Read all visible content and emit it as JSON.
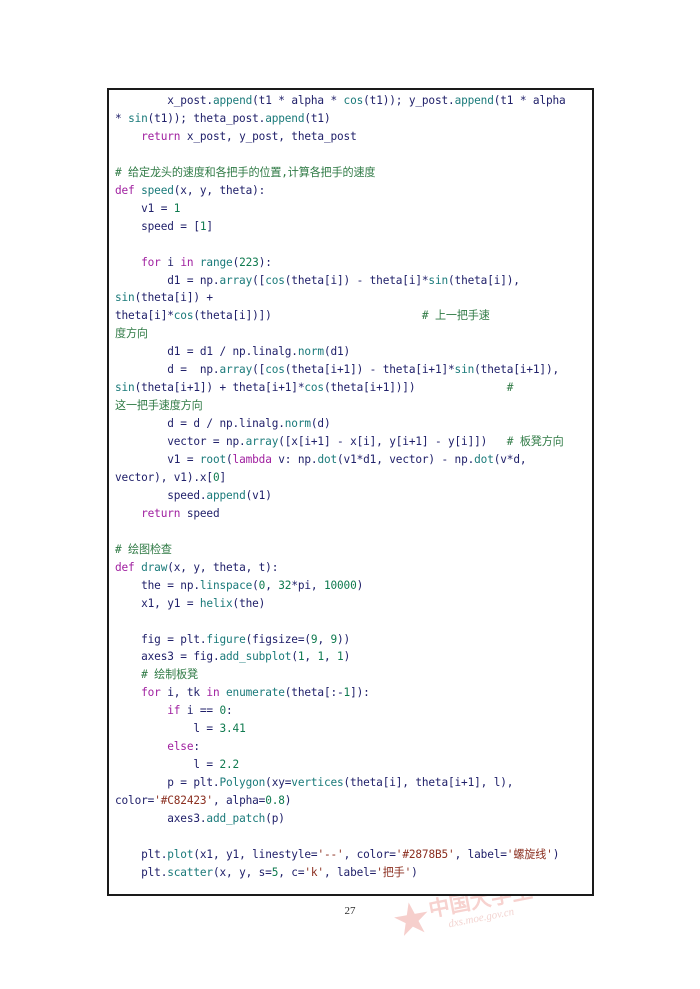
{
  "document": {
    "page_number": "27",
    "watermark": {
      "star": "★",
      "text_cn": "中国大学生",
      "url": "dxs.moe.gov.cn"
    }
  },
  "colors": {
    "keyword": "#a020a0",
    "function": "#1a7a7a",
    "number": "#0f7a4f",
    "string": "#8b2f20",
    "comment": "#2f7a45",
    "identifier": "#20206a",
    "border": "#1a1a1a",
    "polygon_color_literal": "#C82423",
    "plot_color_literal": "#2878B5"
  },
  "code": {
    "language": "python",
    "lines": [
      {
        "indent": 0,
        "tokens": [
          {
            "t": "        ",
            "c": "id"
          },
          {
            "t": "x_post",
            "c": "id"
          },
          {
            "t": ".",
            "c": "id"
          },
          {
            "t": "append",
            "c": "fn"
          },
          {
            "t": "(t1 * alpha * ",
            "c": "id"
          },
          {
            "t": "cos",
            "c": "fn"
          },
          {
            "t": "(t1)); ",
            "c": "id"
          },
          {
            "t": "y_post",
            "c": "id"
          },
          {
            "t": ".",
            "c": "id"
          },
          {
            "t": "append",
            "c": "fn"
          },
          {
            "t": "(t1 * alpha",
            "c": "id"
          }
        ]
      },
      {
        "indent": 0,
        "tokens": [
          {
            "t": "* ",
            "c": "id"
          },
          {
            "t": "sin",
            "c": "fn"
          },
          {
            "t": "(t1)); theta_post",
            "c": "id"
          },
          {
            "t": ".",
            "c": "id"
          },
          {
            "t": "append",
            "c": "fn"
          },
          {
            "t": "(t1)",
            "c": "id"
          }
        ]
      },
      {
        "indent": 0,
        "tokens": [
          {
            "t": "    ",
            "c": "id"
          },
          {
            "t": "return",
            "c": "kw"
          },
          {
            "t": " x_post, y_post, theta_post",
            "c": "id"
          }
        ]
      },
      {
        "indent": 0,
        "tokens": []
      },
      {
        "indent": 0,
        "tokens": [
          {
            "t": "# 给定龙头的速度和各把手的位置,计算各把手的速度",
            "c": "cm"
          }
        ]
      },
      {
        "indent": 0,
        "tokens": [
          {
            "t": "def",
            "c": "kw"
          },
          {
            "t": " ",
            "c": "id"
          },
          {
            "t": "speed",
            "c": "fn"
          },
          {
            "t": "(x, y, theta):",
            "c": "id"
          }
        ]
      },
      {
        "indent": 0,
        "tokens": [
          {
            "t": "    v1 = ",
            "c": "id"
          },
          {
            "t": "1",
            "c": "num"
          }
        ]
      },
      {
        "indent": 0,
        "tokens": [
          {
            "t": "    speed = [",
            "c": "id"
          },
          {
            "t": "1",
            "c": "num"
          },
          {
            "t": "]",
            "c": "id"
          }
        ]
      },
      {
        "indent": 0,
        "tokens": []
      },
      {
        "indent": 0,
        "tokens": [
          {
            "t": "    ",
            "c": "id"
          },
          {
            "t": "for",
            "c": "kw"
          },
          {
            "t": " i ",
            "c": "id"
          },
          {
            "t": "in",
            "c": "kw"
          },
          {
            "t": " ",
            "c": "id"
          },
          {
            "t": "range",
            "c": "fn"
          },
          {
            "t": "(",
            "c": "id"
          },
          {
            "t": "223",
            "c": "num"
          },
          {
            "t": "):",
            "c": "id"
          }
        ]
      },
      {
        "indent": 0,
        "tokens": [
          {
            "t": "        d1 = np.",
            "c": "id"
          },
          {
            "t": "array",
            "c": "fn"
          },
          {
            "t": "([",
            "c": "id"
          },
          {
            "t": "cos",
            "c": "fn"
          },
          {
            "t": "(theta[i]) - theta[i]*",
            "c": "id"
          },
          {
            "t": "sin",
            "c": "fn"
          },
          {
            "t": "(theta[i]),",
            "c": "id"
          }
        ]
      },
      {
        "indent": 0,
        "tokens": [
          {
            "t": "sin",
            "c": "fn"
          },
          {
            "t": "(theta[i]) +",
            "c": "id"
          }
        ]
      },
      {
        "indent": 0,
        "tokens": [
          {
            "t": "theta[i]*",
            "c": "id"
          },
          {
            "t": "cos",
            "c": "fn"
          },
          {
            "t": "(theta[i])])",
            "c": "id"
          },
          {
            "t": "                       ",
            "c": "id"
          },
          {
            "t": "# 上一把手速",
            "c": "cm"
          }
        ]
      },
      {
        "indent": 0,
        "tokens": [
          {
            "t": "度方向",
            "c": "cm"
          }
        ]
      },
      {
        "indent": 0,
        "tokens": [
          {
            "t": "        d1 = d1 / np.linalg.",
            "c": "id"
          },
          {
            "t": "norm",
            "c": "fn"
          },
          {
            "t": "(d1)",
            "c": "id"
          }
        ]
      },
      {
        "indent": 0,
        "tokens": [
          {
            "t": "        d =  np.",
            "c": "id"
          },
          {
            "t": "array",
            "c": "fn"
          },
          {
            "t": "([",
            "c": "id"
          },
          {
            "t": "cos",
            "c": "fn"
          },
          {
            "t": "(theta[i+1]) - theta[i+1]*",
            "c": "id"
          },
          {
            "t": "sin",
            "c": "fn"
          },
          {
            "t": "(theta[i+1]),",
            "c": "id"
          }
        ]
      },
      {
        "indent": 0,
        "tokens": [
          {
            "t": "sin",
            "c": "fn"
          },
          {
            "t": "(theta[i+1]) + theta[i+1]*",
            "c": "id"
          },
          {
            "t": "cos",
            "c": "fn"
          },
          {
            "t": "(theta[i+1])])",
            "c": "id"
          },
          {
            "t": "              ",
            "c": "id"
          },
          {
            "t": "#",
            "c": "cm"
          }
        ]
      },
      {
        "indent": 0,
        "tokens": [
          {
            "t": "这一把手速度方向",
            "c": "cm"
          }
        ]
      },
      {
        "indent": 0,
        "tokens": [
          {
            "t": "        d = d / np.linalg.",
            "c": "id"
          },
          {
            "t": "norm",
            "c": "fn"
          },
          {
            "t": "(d)",
            "c": "id"
          }
        ]
      },
      {
        "indent": 0,
        "tokens": [
          {
            "t": "        vector = np.",
            "c": "id"
          },
          {
            "t": "array",
            "c": "fn"
          },
          {
            "t": "([x[i+1] - x[i], y[i+1] - y[i]])",
            "c": "id"
          },
          {
            "t": "   ",
            "c": "id"
          },
          {
            "t": "# 板凳方向",
            "c": "cm"
          }
        ]
      },
      {
        "indent": 0,
        "tokens": [
          {
            "t": "        v1 = ",
            "c": "id"
          },
          {
            "t": "root",
            "c": "fn"
          },
          {
            "t": "(",
            "c": "id"
          },
          {
            "t": "lambda",
            "c": "kw"
          },
          {
            "t": " v: np.",
            "c": "id"
          },
          {
            "t": "dot",
            "c": "fn"
          },
          {
            "t": "(v1*d1, vector) - np.",
            "c": "id"
          },
          {
            "t": "dot",
            "c": "fn"
          },
          {
            "t": "(v*d,",
            "c": "id"
          }
        ]
      },
      {
        "indent": 0,
        "tokens": [
          {
            "t": "vector), v1).x[",
            "c": "id"
          },
          {
            "t": "0",
            "c": "num"
          },
          {
            "t": "]",
            "c": "id"
          }
        ]
      },
      {
        "indent": 0,
        "tokens": [
          {
            "t": "        speed.",
            "c": "id"
          },
          {
            "t": "append",
            "c": "fn"
          },
          {
            "t": "(v1)",
            "c": "id"
          }
        ]
      },
      {
        "indent": 0,
        "tokens": [
          {
            "t": "    ",
            "c": "id"
          },
          {
            "t": "return",
            "c": "kw"
          },
          {
            "t": " speed",
            "c": "id"
          }
        ]
      },
      {
        "indent": 0,
        "tokens": []
      },
      {
        "indent": 0,
        "tokens": [
          {
            "t": "# 绘图检查",
            "c": "cm"
          }
        ]
      },
      {
        "indent": 0,
        "tokens": [
          {
            "t": "def",
            "c": "kw"
          },
          {
            "t": " ",
            "c": "id"
          },
          {
            "t": "draw",
            "c": "fn"
          },
          {
            "t": "(x, y, theta, t):",
            "c": "id"
          }
        ]
      },
      {
        "indent": 0,
        "tokens": [
          {
            "t": "    the = np.",
            "c": "id"
          },
          {
            "t": "linspace",
            "c": "fn"
          },
          {
            "t": "(",
            "c": "id"
          },
          {
            "t": "0",
            "c": "num"
          },
          {
            "t": ", ",
            "c": "id"
          },
          {
            "t": "32",
            "c": "num"
          },
          {
            "t": "*pi, ",
            "c": "id"
          },
          {
            "t": "10000",
            "c": "num"
          },
          {
            "t": ")",
            "c": "id"
          }
        ]
      },
      {
        "indent": 0,
        "tokens": [
          {
            "t": "    x1, y1 = ",
            "c": "id"
          },
          {
            "t": "helix",
            "c": "fn"
          },
          {
            "t": "(the)",
            "c": "id"
          }
        ]
      },
      {
        "indent": 0,
        "tokens": []
      },
      {
        "indent": 0,
        "tokens": [
          {
            "t": "    fig = plt.",
            "c": "id"
          },
          {
            "t": "figure",
            "c": "fn"
          },
          {
            "t": "(figsize=(",
            "c": "id"
          },
          {
            "t": "9",
            "c": "num"
          },
          {
            "t": ", ",
            "c": "id"
          },
          {
            "t": "9",
            "c": "num"
          },
          {
            "t": "))",
            "c": "id"
          }
        ]
      },
      {
        "indent": 0,
        "tokens": [
          {
            "t": "    axes3 = fig.",
            "c": "id"
          },
          {
            "t": "add_subplot",
            "c": "fn"
          },
          {
            "t": "(",
            "c": "id"
          },
          {
            "t": "1",
            "c": "num"
          },
          {
            "t": ", ",
            "c": "id"
          },
          {
            "t": "1",
            "c": "num"
          },
          {
            "t": ", ",
            "c": "id"
          },
          {
            "t": "1",
            "c": "num"
          },
          {
            "t": ")",
            "c": "id"
          }
        ]
      },
      {
        "indent": 0,
        "tokens": [
          {
            "t": "    ",
            "c": "id"
          },
          {
            "t": "# 绘制板凳",
            "c": "cm"
          }
        ]
      },
      {
        "indent": 0,
        "tokens": [
          {
            "t": "    ",
            "c": "id"
          },
          {
            "t": "for",
            "c": "kw"
          },
          {
            "t": " i, tk ",
            "c": "id"
          },
          {
            "t": "in",
            "c": "kw"
          },
          {
            "t": " ",
            "c": "id"
          },
          {
            "t": "enumerate",
            "c": "fn"
          },
          {
            "t": "(theta[:-",
            "c": "id"
          },
          {
            "t": "1",
            "c": "num"
          },
          {
            "t": "]):",
            "c": "id"
          }
        ]
      },
      {
        "indent": 0,
        "tokens": [
          {
            "t": "        ",
            "c": "id"
          },
          {
            "t": "if",
            "c": "kw"
          },
          {
            "t": " i == ",
            "c": "id"
          },
          {
            "t": "0",
            "c": "num"
          },
          {
            "t": ":",
            "c": "id"
          }
        ]
      },
      {
        "indent": 0,
        "tokens": [
          {
            "t": "            l = ",
            "c": "id"
          },
          {
            "t": "3.41",
            "c": "num"
          }
        ]
      },
      {
        "indent": 0,
        "tokens": [
          {
            "t": "        ",
            "c": "id"
          },
          {
            "t": "else",
            "c": "kw"
          },
          {
            "t": ":",
            "c": "id"
          }
        ]
      },
      {
        "indent": 0,
        "tokens": [
          {
            "t": "            l = ",
            "c": "id"
          },
          {
            "t": "2.2",
            "c": "num"
          }
        ]
      },
      {
        "indent": 0,
        "tokens": [
          {
            "t": "        p = plt.",
            "c": "id"
          },
          {
            "t": "Polygon",
            "c": "fn"
          },
          {
            "t": "(xy=",
            "c": "id"
          },
          {
            "t": "vertices",
            "c": "fn"
          },
          {
            "t": "(theta[i], theta[i+1], l),",
            "c": "id"
          }
        ]
      },
      {
        "indent": 0,
        "tokens": [
          {
            "t": "color=",
            "c": "id"
          },
          {
            "t": "'#C82423'",
            "c": "str"
          },
          {
            "t": ", alpha=",
            "c": "id"
          },
          {
            "t": "0.8",
            "c": "num"
          },
          {
            "t": ")",
            "c": "id"
          }
        ]
      },
      {
        "indent": 0,
        "tokens": [
          {
            "t": "        axes3.",
            "c": "id"
          },
          {
            "t": "add_patch",
            "c": "fn"
          },
          {
            "t": "(p)",
            "c": "id"
          }
        ]
      },
      {
        "indent": 0,
        "tokens": []
      },
      {
        "indent": 0,
        "tokens": [
          {
            "t": "    plt.",
            "c": "id"
          },
          {
            "t": "plot",
            "c": "fn"
          },
          {
            "t": "(x1, y1, linestyle=",
            "c": "id"
          },
          {
            "t": "'--'",
            "c": "str"
          },
          {
            "t": ", color=",
            "c": "id"
          },
          {
            "t": "'#2878B5'",
            "c": "str"
          },
          {
            "t": ", label=",
            "c": "id"
          },
          {
            "t": "'螺旋线'",
            "c": "str"
          },
          {
            "t": ")",
            "c": "id"
          }
        ]
      },
      {
        "indent": 0,
        "tokens": [
          {
            "t": "    plt.",
            "c": "id"
          },
          {
            "t": "scatter",
            "c": "fn"
          },
          {
            "t": "(x, y, s=",
            "c": "id"
          },
          {
            "t": "5",
            "c": "num"
          },
          {
            "t": ", c=",
            "c": "id"
          },
          {
            "t": "'k'",
            "c": "str"
          },
          {
            "t": ", label=",
            "c": "id"
          },
          {
            "t": "'把手'",
            "c": "str"
          },
          {
            "t": ")",
            "c": "id"
          }
        ]
      }
    ]
  }
}
